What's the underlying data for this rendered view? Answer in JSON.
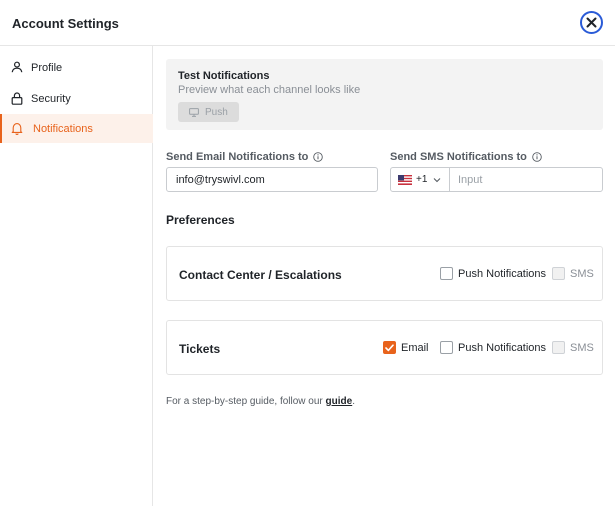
{
  "header": {
    "title": "Account Settings",
    "close_icon": "close-icon"
  },
  "sidebar": {
    "items": [
      {
        "label": "Profile",
        "icon": "user-icon",
        "active": false
      },
      {
        "label": "Security",
        "icon": "lock-icon",
        "active": false
      },
      {
        "label": "Notifications",
        "icon": "bell-icon",
        "active": true
      }
    ]
  },
  "test_notifications": {
    "title": "Test Notifications",
    "subtitle": "Preview what each channel looks like",
    "push_button_label": "Push",
    "push_icon": "monitor-icon",
    "push_enabled": false
  },
  "email_field": {
    "label": "Send Email Notifications to",
    "value": "info@tryswivl.com"
  },
  "sms_field": {
    "label": "Send SMS Notifications to",
    "country_flag": "us-flag-icon",
    "country_code": "+1",
    "placeholder": "Input"
  },
  "preferences": {
    "title": "Preferences",
    "cards": [
      {
        "title": "Contact Center / Escalations",
        "options": [
          {
            "label": "Push Notifications",
            "checked": false,
            "disabled": false
          },
          {
            "label": "SMS",
            "checked": false,
            "disabled": true
          }
        ]
      },
      {
        "title": "Tickets",
        "options": [
          {
            "label": "Email",
            "checked": true,
            "disabled": false
          },
          {
            "label": "Push Notifications",
            "checked": false,
            "disabled": false
          },
          {
            "label": "SMS",
            "checked": false,
            "disabled": true
          }
        ]
      }
    ]
  },
  "footer": {
    "guide_prefix": "For a step-by-step guide, follow our ",
    "guide_link": "guide",
    "guide_suffix": "."
  },
  "colors": {
    "accent": "#e8631c",
    "close_ring": "#2a5bd7",
    "active_bg": "#fdf1ea"
  }
}
